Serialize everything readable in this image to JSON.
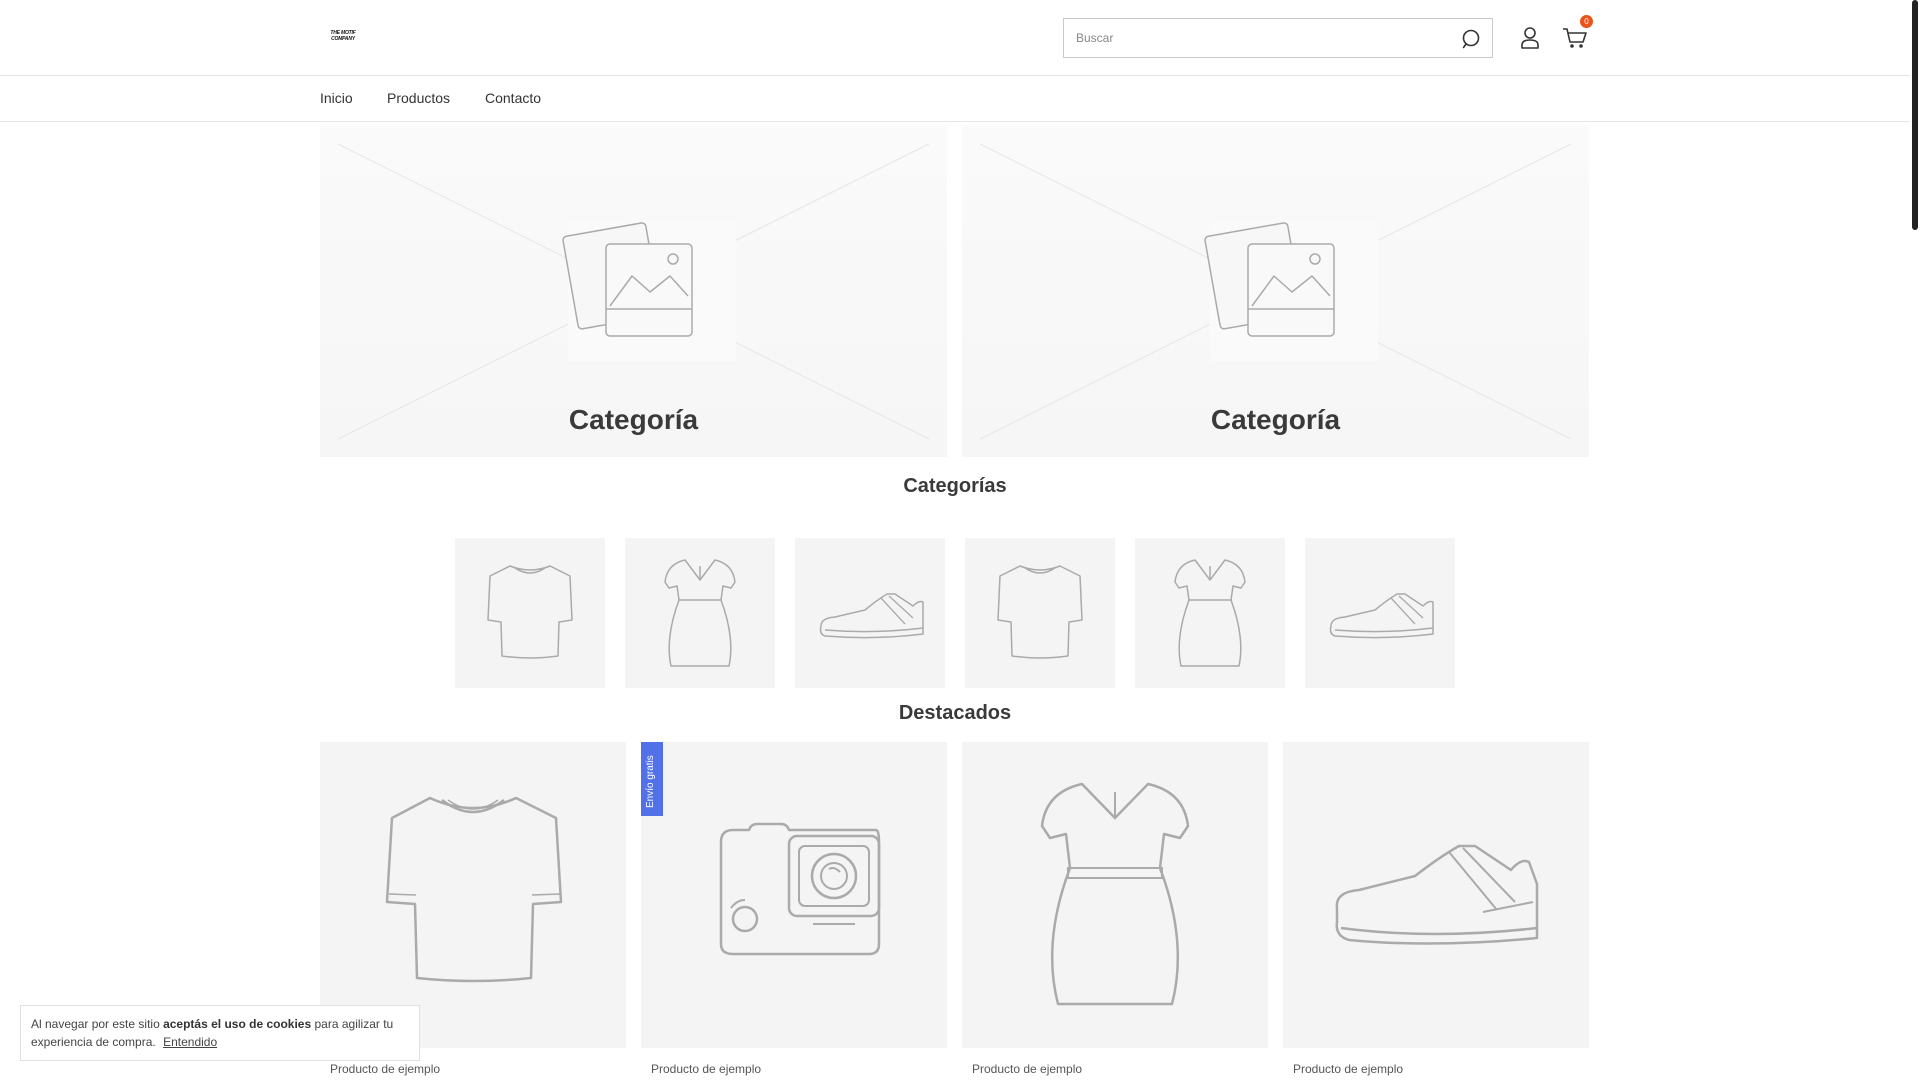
{
  "header": {
    "logo_line1": "THE MOTIF",
    "logo_line2": "COMPANY",
    "search_placeholder": "Buscar",
    "search_value": "",
    "cart_count": "0"
  },
  "nav": {
    "items": [
      "Inicio",
      "Productos",
      "Contacto"
    ]
  },
  "banners": [
    {
      "label": "Categoría"
    },
    {
      "label": "Categoría"
    }
  ],
  "categories_section": {
    "title": "Categorías",
    "items": [
      {
        "icon": "tshirt-icon"
      },
      {
        "icon": "dress-icon"
      },
      {
        "icon": "sneaker-icon"
      },
      {
        "icon": "tshirt-icon"
      },
      {
        "icon": "dress-icon"
      },
      {
        "icon": "sneaker-icon"
      }
    ]
  },
  "featured_section": {
    "title": "Destacados",
    "products": [
      {
        "name": "Producto de ejemplo",
        "icon": "tshirt-icon"
      },
      {
        "name": "Producto de ejemplo",
        "icon": "camera-icon",
        "badge": "Envío gratis"
      },
      {
        "name": "Producto de ejemplo",
        "icon": "dress-icon"
      },
      {
        "name": "Producto de ejemplo",
        "icon": "sneaker-icon"
      }
    ]
  },
  "cookie": {
    "text_before": "Al navegar por este sitio ",
    "text_bold": "aceptás el uso de cookies",
    "text_after": " para agilizar tu experiencia de compra.",
    "accept_label": "Entendido"
  },
  "colors": {
    "badge": "#e8541c",
    "ribbon": "#5270e8",
    "placeholder_bg": "#f4f4f4"
  }
}
